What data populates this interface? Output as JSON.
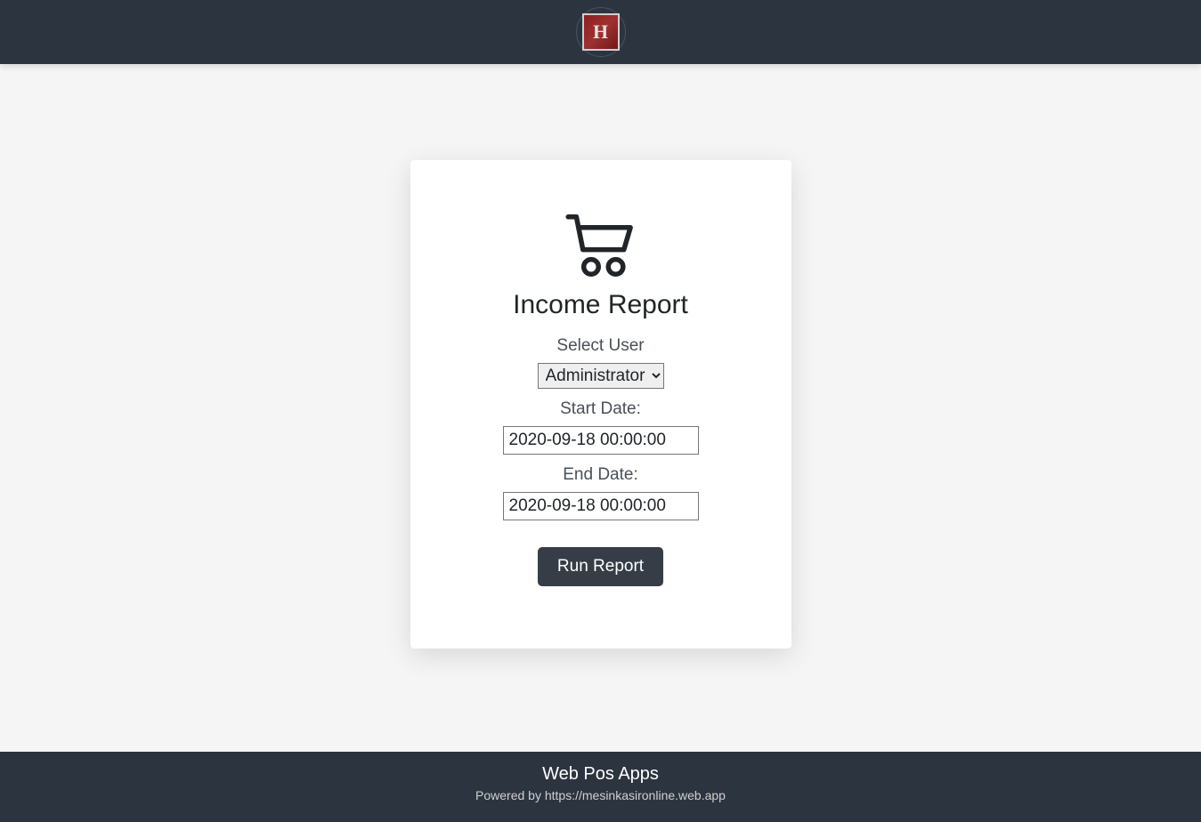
{
  "header": {
    "logo_letter": "H"
  },
  "card": {
    "title": "Income Report",
    "select_user_label": "Select User",
    "user_selected": "Administrator",
    "start_date_label": "Start Date:",
    "start_date_value": "2020-09-18 00:00:00",
    "end_date_label": "End Date:",
    "end_date_value": "2020-09-18 00:00:00",
    "run_button_label": "Run Report"
  },
  "footer": {
    "title": "Web Pos Apps",
    "subtitle": "Powered by https://mesinkasironline.web.app"
  }
}
